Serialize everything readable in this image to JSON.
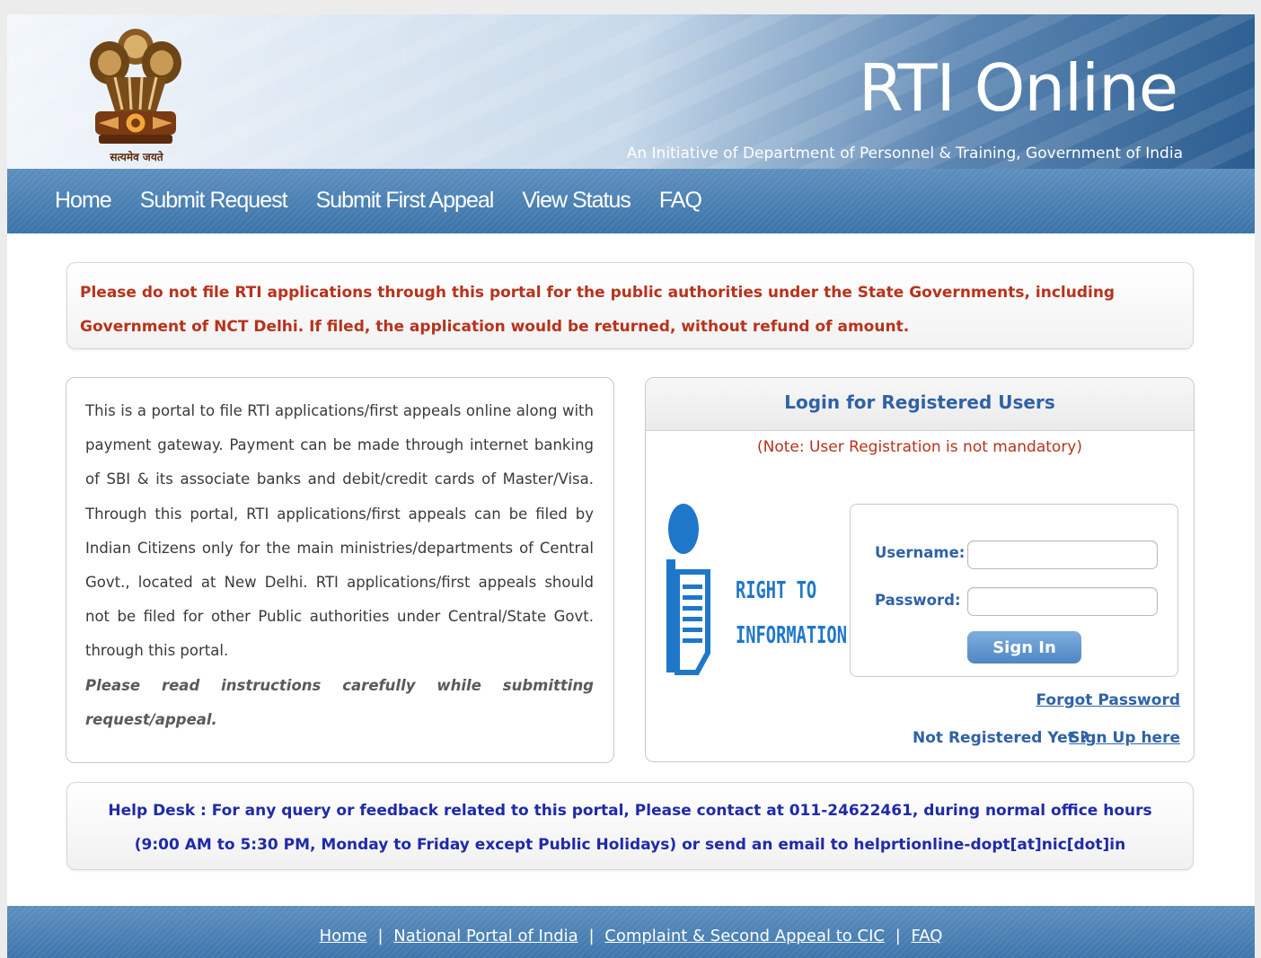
{
  "header": {
    "emblem_motto": "सत्यमेव जयते",
    "title": "RTI Online",
    "subtitle": "An Initiative of Department of Personnel & Training, Government of India"
  },
  "nav": {
    "items": [
      {
        "label": "Home"
      },
      {
        "label": "Submit Request"
      },
      {
        "label": "Submit First Appeal"
      },
      {
        "label": "View Status"
      },
      {
        "label": "FAQ"
      }
    ]
  },
  "notice": {
    "text": "Please do not file RTI applications through this portal for the public authorities under the State Governments, including Government of NCT Delhi. If filed, the application would be returned, without refund of amount."
  },
  "info": {
    "text": "This is a portal to file RTI applications/first appeals online along with payment gateway. Payment can be made through internet banking of SBI & its associate banks and debit/credit cards of Master/Visa. Through this portal, RTI applications/first appeals can be filed by Indian Citizens only for the main ministries/departments of Central Govt., located at New Delhi. RTI applications/first appeals should not be filed for other Public authorities under Central/State Govt. through this portal.",
    "emphasis": "Please read instructions carefully while submitting request/appeal."
  },
  "login": {
    "title": "Login for Registered Users",
    "note": "(Note: User Registration is not mandatory)",
    "logo_line1": "RIGHT TO",
    "logo_line2": "INFORMATION",
    "username_label": "Username:",
    "username_value": "",
    "password_label": "Password:",
    "password_value": "",
    "signin_label": "Sign In",
    "forgot_label": "Forgot Password",
    "not_registered_label": "Not Registered Yet ?",
    "signup_label": "Sign Up here"
  },
  "helpdesk": {
    "line1": "Help Desk : For any query or feedback related to this portal, Please contact at 011-24622461, during normal office hours",
    "line2": "(9:00 AM to 5:30 PM, Monday to Friday except Public Holidays) or send an email to helprtionline-dopt[at]nic[dot]in"
  },
  "footer": {
    "links": [
      {
        "label": "Home"
      },
      {
        "label": "National Portal of India"
      },
      {
        "label": "Complaint & Second Appeal to CIC"
      },
      {
        "label": "FAQ"
      }
    ],
    "separator": "|"
  },
  "colors": {
    "header_dark": "#2a5d91",
    "nav_blue": "#4a80b5",
    "notice_red": "#b8321c",
    "link_blue": "#2f62a5",
    "helpdesk_blue": "#1f2aa8",
    "rti_logo_blue": "#1f77c9",
    "button_blue": "#5f95cf"
  },
  "icons": {
    "emblem": "ashoka-emblem-icon",
    "rti_logo": "right-to-information-icon"
  }
}
